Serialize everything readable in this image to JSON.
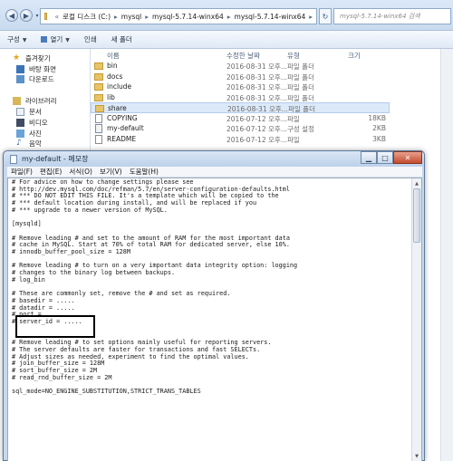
{
  "explorer": {
    "breadcrumb": [
      "로컬 디스크 (C:)",
      "mysql",
      "mysql-5.7.14-winx64",
      "mysql-5.7.14-winx64"
    ],
    "search_placeholder": "mysql-5.7.14-winx64 검색",
    "toolbar": {
      "organize": "구성",
      "open": "열기",
      "print": "인쇄",
      "new_folder": "새 폴더"
    },
    "nav": {
      "favorites": "즐겨찾기",
      "desktop": "바탕 화면",
      "downloads": "다운로드",
      "libraries": "라이브러리",
      "documents": "문서",
      "videos": "비디오",
      "pictures": "사진",
      "music": "음악"
    },
    "columns": {
      "name": "이름",
      "date": "수정한 날짜",
      "type": "유형",
      "size": "크기"
    },
    "files": [
      {
        "name": "bin",
        "date": "2016-08-31 오후...",
        "type": "파일 폴더",
        "size": "",
        "icon": "folder-icon"
      },
      {
        "name": "docs",
        "date": "2016-08-31 오후...",
        "type": "파일 폴더",
        "size": "",
        "icon": "folder-icon"
      },
      {
        "name": "include",
        "date": "2016-08-31 오후...",
        "type": "파일 폴더",
        "size": "",
        "icon": "folder-icon"
      },
      {
        "name": "lib",
        "date": "2016-08-31 오후...",
        "type": "파일 폴더",
        "size": "",
        "icon": "folder-icon"
      },
      {
        "name": "share",
        "date": "2016-08-31 오후...",
        "type": "파일 폴더",
        "size": "",
        "icon": "folder-icon"
      },
      {
        "name": "COPYING",
        "date": "2016-07-12 오후...",
        "type": "파일",
        "size": "18KB",
        "icon": "file-icon"
      },
      {
        "name": "my-default",
        "date": "2016-07-12 오후...",
        "type": "구성 설정",
        "size": "2KB",
        "icon": "config-file-icon"
      },
      {
        "name": "README",
        "date": "2016-07-12 오후...",
        "type": "파일",
        "size": "3KB",
        "icon": "file-icon"
      }
    ]
  },
  "notepad": {
    "title": "my-default - 메모장",
    "menus": [
      "파일(F)",
      "편집(E)",
      "서식(O)",
      "보기(V)",
      "도움말(H)"
    ],
    "content": "# For advice on how to change settings please see\n# http://dev.mysql.com/doc/refman/5.7/en/server-configuration-defaults.html\n# *** DO NOT EDIT THIS FILE. It's a template which will be copied to the\n# *** default location during install, and will be replaced if you\n# *** upgrade to a newer version of MySQL.\n\n[mysqld]\n\n# Remove leading # and set to the amount of RAM for the most important data\n# cache in MySQL. Start at 70% of total RAM for dedicated server, else 10%.\n# innodb_buffer_pool_size = 128M\n\n# Remove leading # to turn on a very important data integrity option: logging\n# changes to the binary log between backups.\n# log_bin\n\n# These are commonly set, remove the # and set as required.\n# basedir = .....\n# datadir = .....\n# port = .....\n# server_id = .....\n\n\n# Remove leading # to set options mainly useful for reporting servers.\n# The server defaults are faster for transactions and fast SELECTs.\n# Adjust sizes as needed, experiment to find the optimal values.\n# join_buffer_size = 128M\n# sort_buffer_size = 2M\n# read_rnd_buffer_size = 2M\n\nsql_mode=NO_ENGINE_SUBSTITUTION,STRICT_TRANS_TABLES"
  }
}
